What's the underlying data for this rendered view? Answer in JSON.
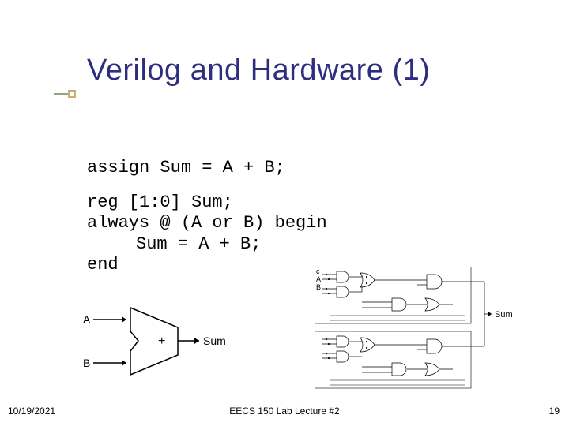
{
  "title": "Verilog and Hardware (1)",
  "code": {
    "assign_line": "assign Sum = A + B;",
    "reg_line": "reg [1:0]   Sum;",
    "always_line": "always @ (A or B) begin",
    "body_line": "Sum = A + B;",
    "end_line": "end"
  },
  "adder": {
    "input_a": "A",
    "input_b": "B",
    "op": "+",
    "output": "Sum"
  },
  "gates": {
    "label_a": "A",
    "label_b": "B",
    "label_c": "c",
    "output": "Sum"
  },
  "footer": {
    "date": "10/19/2021",
    "center": "EECS 150 Lab Lecture #2",
    "page": "19"
  }
}
